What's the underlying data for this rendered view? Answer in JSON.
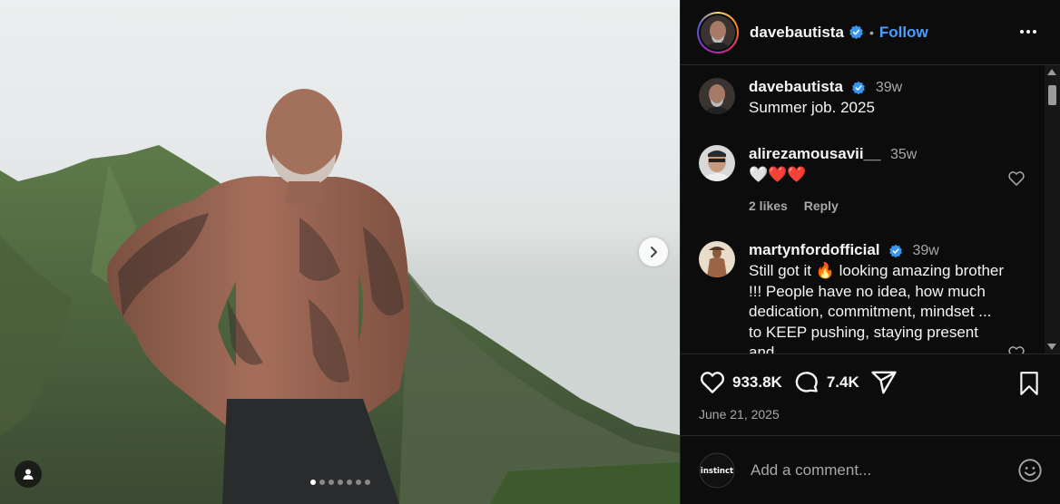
{
  "post": {
    "author": "davebautista",
    "follow_label": "Follow",
    "separator": "•",
    "carousel_count": 7,
    "carousel_active_index": 0
  },
  "caption": {
    "username": "davebautista",
    "age": "39w",
    "text": "Summer job. 2025"
  },
  "comments": [
    {
      "username": "alirezamousavii__",
      "age": "35w",
      "text": "🤍❤️❤️",
      "likes": "2 likes",
      "reply": "Reply"
    },
    {
      "username": "martynfordofficial",
      "age": "39w",
      "text": "Still got it 🔥 looking amazing brother !!! People have no idea, how much dedication, commitment, mindset ... to KEEP pushing, staying present and"
    }
  ],
  "actions": {
    "likes": "933.8K",
    "comments": "7.4K"
  },
  "date": "June 21, 2025",
  "add_comment": {
    "avatar_label": "instinct",
    "placeholder": "Add a comment..."
  },
  "colors": {
    "accent": "#4a9eff",
    "verified": "#3897f0",
    "panel_bg": "#0c0c0c"
  }
}
